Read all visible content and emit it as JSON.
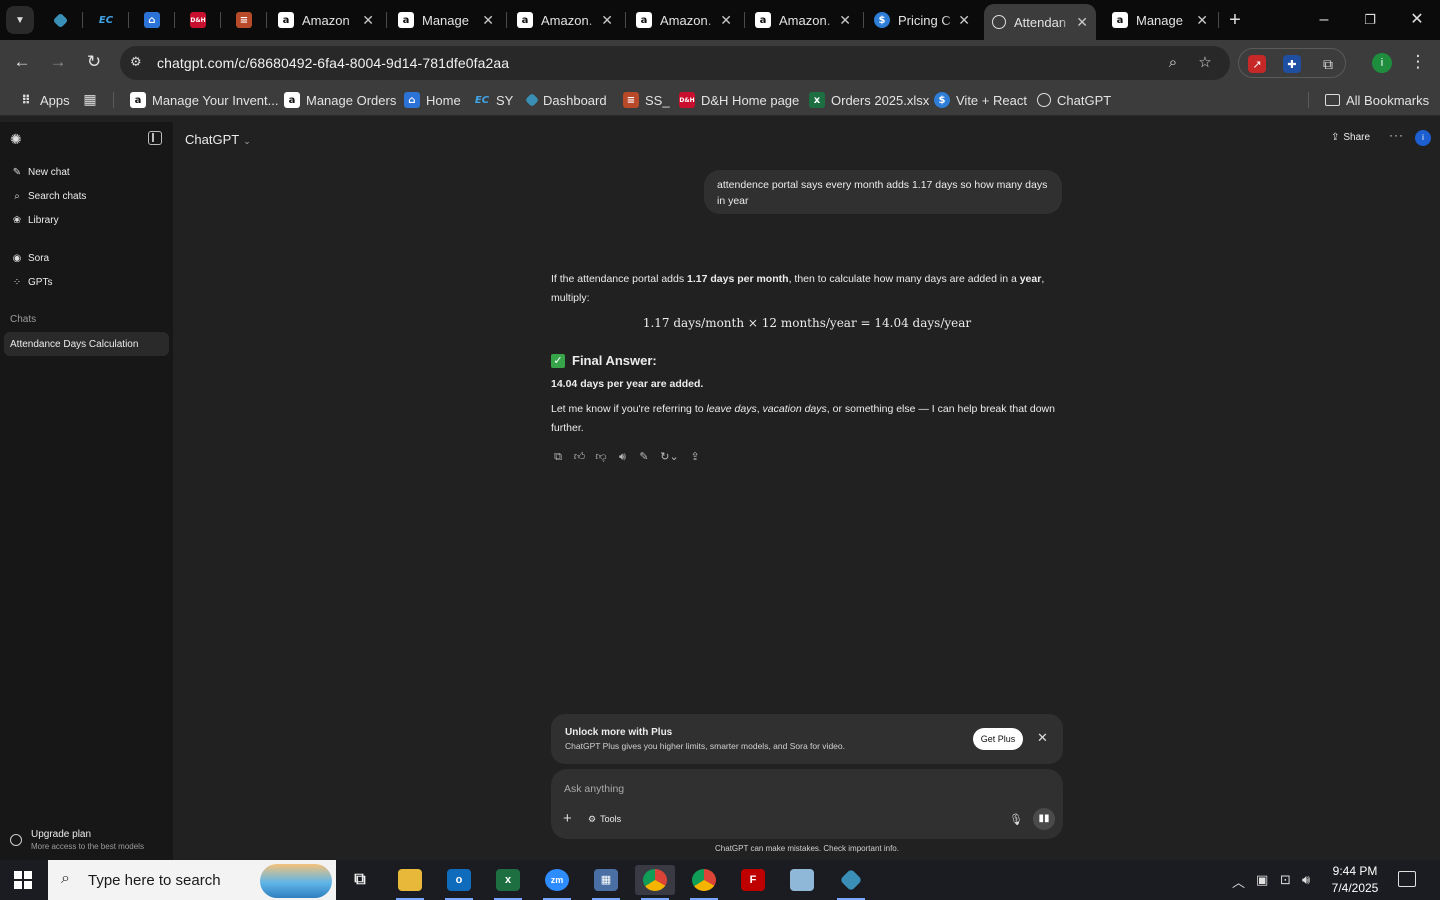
{
  "browser": {
    "tabs": [
      {
        "title": "Amazon",
        "icon": "amazon-icon"
      },
      {
        "title": "Manage",
        "icon": "amazon-icon"
      },
      {
        "title": "Amazon.",
        "icon": "amazon-icon"
      },
      {
        "title": "Amazon.",
        "icon": "amazon-icon"
      },
      {
        "title": "Amazon.",
        "icon": "amazon-icon"
      },
      {
        "title": "Pricing C",
        "icon": "dollar-icon"
      },
      {
        "title": "Attendan",
        "icon": "openai-icon"
      },
      {
        "title": "Manage",
        "icon": "amazon-icon"
      }
    ],
    "pinned_labels": {
      "ec": "EC",
      "dh": "D&H"
    },
    "url": "chatgpt.com/c/68680492-6fa4-8004-9d14-781dfe0fa2aa",
    "bookmarks": {
      "apps": "Apps",
      "items": [
        "Manage Your Invent...",
        "Manage Orders",
        "Home",
        "SY",
        "Dashboard",
        "SS_",
        "D&H Home page",
        "Orders 2025.xlsx",
        "Vite + React",
        "ChatGPT"
      ],
      "all": "All Bookmarks"
    }
  },
  "sidebar": {
    "new_chat": "New chat",
    "search_chats": "Search chats",
    "library": "Library",
    "sora": "Sora",
    "gpts": "GPTs",
    "chats_heading": "Chats",
    "active_chat": "Attendance Days Calculation",
    "upgrade_title": "Upgrade plan",
    "upgrade_sub": "More access to the best models"
  },
  "header": {
    "model": "ChatGPT",
    "share": "Share",
    "avatar_initial": "i"
  },
  "conversation": {
    "user_message": "attendence portal says every month adds 1.17 days so how many days in year",
    "answer_intro_1": "If the attendance portal adds ",
    "answer_bold_1": "1.17 days per month",
    "answer_intro_2": ", then to calculate how many days are added in a ",
    "answer_bold_2": "year",
    "answer_intro_3": ", multiply:",
    "formula": "1.17 days/month × 12 months/year = 14.04 days/year",
    "final_heading": "Final Answer:",
    "final_body": "14.04 days per year are added.",
    "followup_1": "Let me know if you're referring to ",
    "followup_i1": "leave days",
    "followup_2": ", ",
    "followup_i2": "vacation days",
    "followup_3": ", or something else — I can help break that down further."
  },
  "upsell": {
    "title": "Unlock more with Plus",
    "subtitle": "ChatGPT Plus gives you higher limits, smarter models, and Sora for video.",
    "button": "Get Plus"
  },
  "composer": {
    "placeholder": "Ask anything",
    "tools": "Tools",
    "disclaimer": "ChatGPT can make mistakes. Check important info."
  },
  "taskbar": {
    "search_placeholder": "Type here to search",
    "apps": [
      "task-view-icon",
      "file-explorer-icon",
      "outlook-icon",
      "excel-icon",
      "zoom-icon",
      "calculator-icon",
      "chrome-icon",
      "chrome-icon",
      "filezilla-icon",
      "notepad-icon",
      "app-icon"
    ],
    "time": "9:44 PM",
    "date": "7/4/2025"
  }
}
